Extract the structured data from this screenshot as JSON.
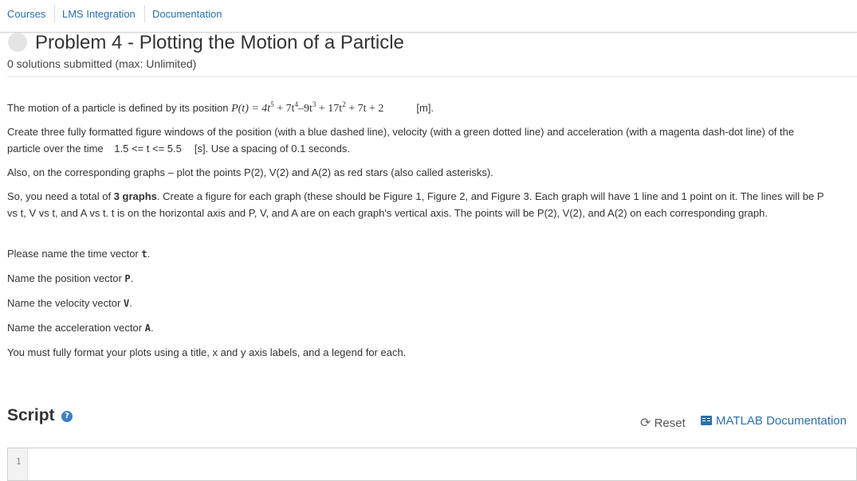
{
  "nav": {
    "links": [
      "Courses",
      "LMS Integration",
      "Documentation"
    ]
  },
  "problem": {
    "title": "Problem 4 - Plotting the Motion of a Particle",
    "solutions": "0 solutions submitted (max: Unlimited)"
  },
  "description": {
    "p1_prefix": "The motion of a particle is defined by its position ",
    "equation": {
      "lhs": "P(t) = 4t",
      "e1": "5",
      "t2": " + 7t",
      "e2": "4",
      "t3": "–9t",
      "e3": "3",
      "t4": " + 17t",
      "e4": "2",
      "t5": " + 7t + 2"
    },
    "p1_unit": "[m].",
    "p2_a": "Create three fully formatted figure windows of the position (with a blue dashed line), velocity (with a green dotted line) and acceleration (with a magenta dash-dot line) of the particle over the time ",
    "p2_range": "1.5 <= t <= 5.5",
    "p2_b": "[s]. Use a spacing of 0.1 seconds.",
    "p3": "Also, on the corresponding graphs – plot the points P(2), V(2) and A(2) as red stars (also called asterisks).",
    "p4_a": "So, you need a total of ",
    "p4_bold": "3 graphs",
    "p4_b": ". Create a figure for each graph (these should be Figure 1, Figure 2, and Figure 3. Each graph will have 1 line and 1 point on it. The lines will be P vs t, V vs t, and A vs t. t is on the horizontal axis and P, V, and A are on each graph's vertical axis. The points will be P(2), V(2), and A(2) on each corresponding graph.",
    "p5_a": "Please name the time vector ",
    "p5_var": "t",
    "p5_b": ".",
    "p6_a": "Name the position vector ",
    "p6_var": "P",
    "p6_b": ".",
    "p7_a": "Name the velocity vector ",
    "p7_var": "V",
    "p7_b": ".",
    "p8_a": "Name the acceleration vector ",
    "p8_var": "A",
    "p8_b": ".",
    "p9": "You must fully format your plots using a title, x and y axis labels, and a legend for each."
  },
  "script": {
    "title": "Script",
    "help": "?",
    "reset_icon": "⟳",
    "reset_label": "Reset",
    "doc_label": "MATLAB Documentation",
    "line_number": "1"
  }
}
